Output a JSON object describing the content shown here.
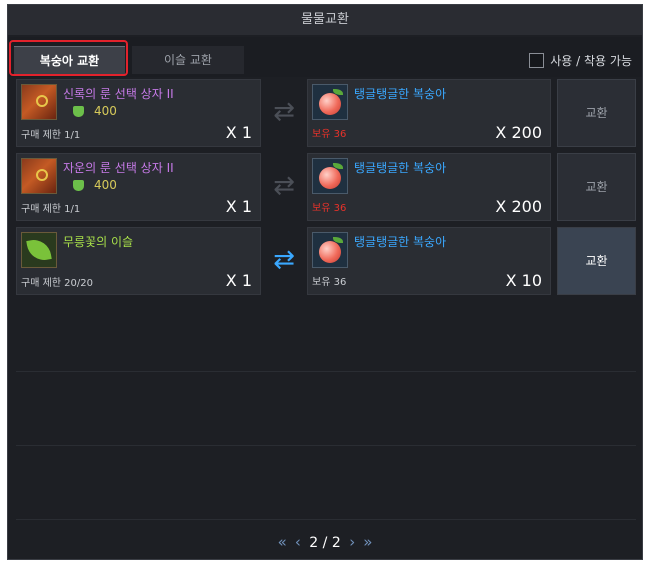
{
  "window": {
    "title": "물물교환"
  },
  "tabs": {
    "active": "복숭아 교환",
    "inactive": "이슬 교환"
  },
  "filter": {
    "label": "사용 / 착용 가능"
  },
  "rows": [
    {
      "item_name": "신록의 룬 선택 상자 II",
      "item_color": "purple",
      "cost": "400",
      "limit": "구매 제한 1/1",
      "qty": "X 1",
      "reward_name": "탱글탱글한 복숭아",
      "owned": "보유 36",
      "owned_color": "red",
      "reward_qty": "X 200",
      "button": "교환",
      "enabled": false
    },
    {
      "item_name": "자운의 룬 선택 상자 II",
      "item_color": "purple",
      "cost": "400",
      "limit": "구매 제한 1/1",
      "qty": "X 1",
      "reward_name": "탱글탱글한 복숭아",
      "owned": "보유 36",
      "owned_color": "red",
      "reward_qty": "X 200",
      "button": "교환",
      "enabled": false
    },
    {
      "item_name": "무릉꽃의 이슬",
      "item_color": "green",
      "cost": "",
      "limit": "구매 제한 20/20",
      "qty": "X 1",
      "reward_name": "탱글탱글한 복숭아",
      "owned": "보유 36",
      "owned_color": "white",
      "reward_qty": "X 10",
      "button": "교환",
      "enabled": true
    }
  ],
  "pager": {
    "current": "2",
    "separator": "/",
    "total": "2"
  },
  "icons": {
    "first": "double-left-icon",
    "prev": "chevron-left-icon",
    "next": "chevron-right-icon",
    "last": "double-right-icon",
    "swap": "swap-arrows-icon"
  }
}
